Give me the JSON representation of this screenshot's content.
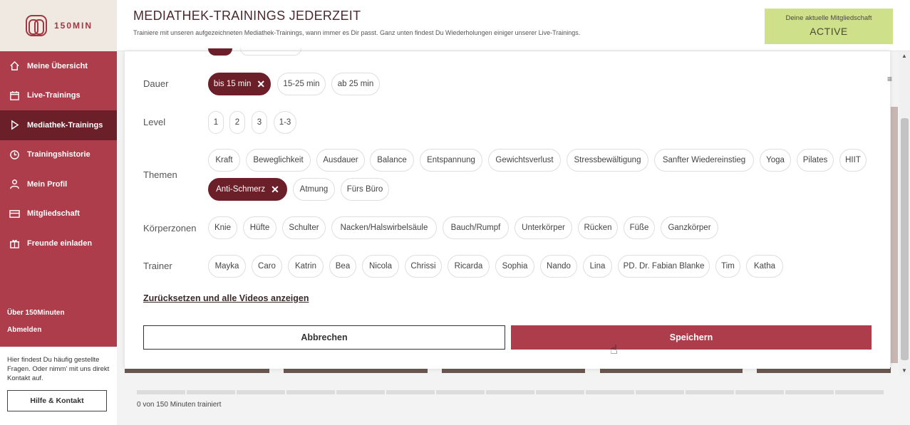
{
  "logo": {
    "text": "150MIN"
  },
  "nav": {
    "items": [
      {
        "label": "Meine Übersicht",
        "icon": "home-icon"
      },
      {
        "label": "Live-Trainings",
        "icon": "calendar-icon"
      },
      {
        "label": "Mediathek-Trainings",
        "icon": "play-icon",
        "active": true
      },
      {
        "label": "Trainingshistorie",
        "icon": "clock-icon"
      },
      {
        "label": "Mein Profil",
        "icon": "user-icon"
      },
      {
        "label": "Mitgliedschaft",
        "icon": "card-icon"
      },
      {
        "label": "Freunde einladen",
        "icon": "gift-icon"
      }
    ],
    "about": "Über 150Minuten",
    "logout": "Abmelden"
  },
  "help": {
    "text": "Hier findest Du häufig gestellte Fragen. Oder nimm' mit uns direkt Kontakt auf.",
    "button": "Hilfe & Kontakt"
  },
  "header": {
    "title": "MEDIATHEK-TRAININGS JEDERZEIT",
    "subtitle": "Trainiere mit unseren aufgezeichneten Mediathek-Trainings, wann immer es Dir passt. Ganz unten findest Du Wiederholungen einiger unserer Live-Trainings.",
    "membership_label": "Deine aktuelle Mitgliedschaft",
    "membership_value": "ACTIVE"
  },
  "filters": {
    "dauer": {
      "label": "Dauer",
      "options": [
        "bis 15 min",
        "15-25 min",
        "ab 25 min"
      ],
      "selected": [
        "bis 15 min"
      ]
    },
    "level": {
      "label": "Level",
      "options": [
        "1",
        "2",
        "3",
        "1-3"
      ]
    },
    "themen": {
      "label": "Themen",
      "options": [
        "Kraft",
        "Beweglichkeit",
        "Ausdauer",
        "Balance",
        "Entspannung",
        "Gewichtsverlust",
        "Stressbewältigung",
        "Sanfter Wiedereinstieg",
        "Yoga",
        "Pilates",
        "HIIT",
        "Anti-Schmerz",
        "Atmung",
        "Fürs Büro"
      ],
      "selected": [
        "Anti-Schmerz"
      ]
    },
    "koerperzonen": {
      "label": "Körperzonen",
      "options": [
        "Knie",
        "Hüfte",
        "Schulter",
        "Nacken/Halswirbelsäule",
        "Bauch/Rumpf",
        "Unterkörper",
        "Rücken",
        "Füße",
        "Ganzkörper"
      ]
    },
    "trainer": {
      "label": "Trainer",
      "options": [
        "Mayka",
        "Caro",
        "Katrin",
        "Bea",
        "Nicola",
        "Chrissi",
        "Ricarda",
        "Sophia",
        "Nando",
        "Lina",
        "PD. Dr. Fabian Blanke",
        "Tim",
        "Katha"
      ]
    }
  },
  "actions": {
    "reset": "Zurücksetzen und alle Videos anzeigen",
    "cancel": "Abbrechen",
    "save": "Speichern"
  },
  "progress": {
    "text": "0 von 150 Minuten trainiert",
    "minutes_done": 0,
    "minutes_goal": 150
  },
  "colors": {
    "brand": "#ad3d4a",
    "selected_chip": "#6b1f28",
    "membership_bg": "#cfe08a"
  }
}
